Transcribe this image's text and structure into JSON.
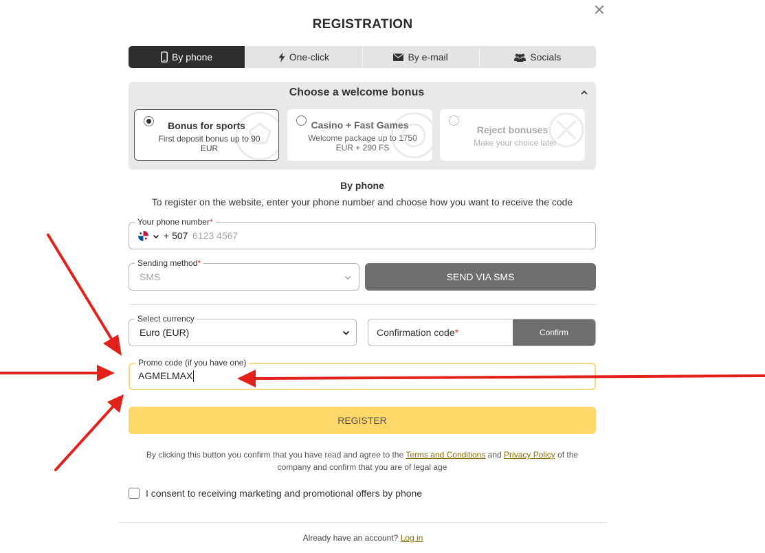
{
  "header": {
    "title": "REGISTRATION",
    "close_icon": "close-icon"
  },
  "tabs": [
    {
      "label": "By phone",
      "icon": "phone-icon",
      "active": true
    },
    {
      "label": "One-click",
      "icon": "lightning-icon",
      "active": false
    },
    {
      "label": "By e-mail",
      "icon": "envelope-icon",
      "active": false
    },
    {
      "label": "Socials",
      "icon": "people-icon",
      "active": false
    }
  ],
  "bonus": {
    "title": "Choose a welcome bonus",
    "options": [
      {
        "name": "Bonus for sports",
        "desc": "First deposit bonus up to 90 EUR",
        "selected": true
      },
      {
        "name": "Casino + Fast Games",
        "desc": "Welcome package up to 1750 EUR + 290 FS",
        "selected": false
      },
      {
        "name": "Reject bonuses",
        "desc": "Make your choice later",
        "selected": false
      }
    ]
  },
  "section": {
    "heading": "By phone",
    "description": "To register on the website, enter your phone number and choose how you want to receive the code"
  },
  "phone": {
    "label": "Your phone number",
    "required_mark": "*",
    "prefix": "+ 507",
    "placeholder": "6123 4567"
  },
  "sending": {
    "label": "Sending method",
    "required_mark": "*",
    "value": "SMS"
  },
  "send_button": "SEND VIA SMS",
  "currency": {
    "label": "Select currency",
    "value": "Euro (EUR)"
  },
  "confirmation": {
    "placeholder": "Confirmation code",
    "required_mark": "*",
    "button": "Confirm"
  },
  "promo": {
    "label": "Promo code (if you have one)",
    "value": "AGMELMAX"
  },
  "register_button": "REGISTER",
  "terms": {
    "pre": "By clicking this button you confirm that you have read and agree to the ",
    "terms_link": "Terms and Conditions",
    "and": " and ",
    "privacy_link": "Privacy Policy",
    "post": " of the company and confirm that you are of legal age"
  },
  "consent": {
    "label": "I consent to receiving marketing and promotional offers by phone",
    "checked": false
  },
  "footer": {
    "text": "Already have an account? ",
    "login_link": "Log in"
  },
  "colors": {
    "accent_yellow": "#ffd86a",
    "active_tab": "#2d2d2d",
    "dark_button": "#6e6e6e",
    "annotation_red": "#e3211b",
    "link": "#8a6d00"
  }
}
